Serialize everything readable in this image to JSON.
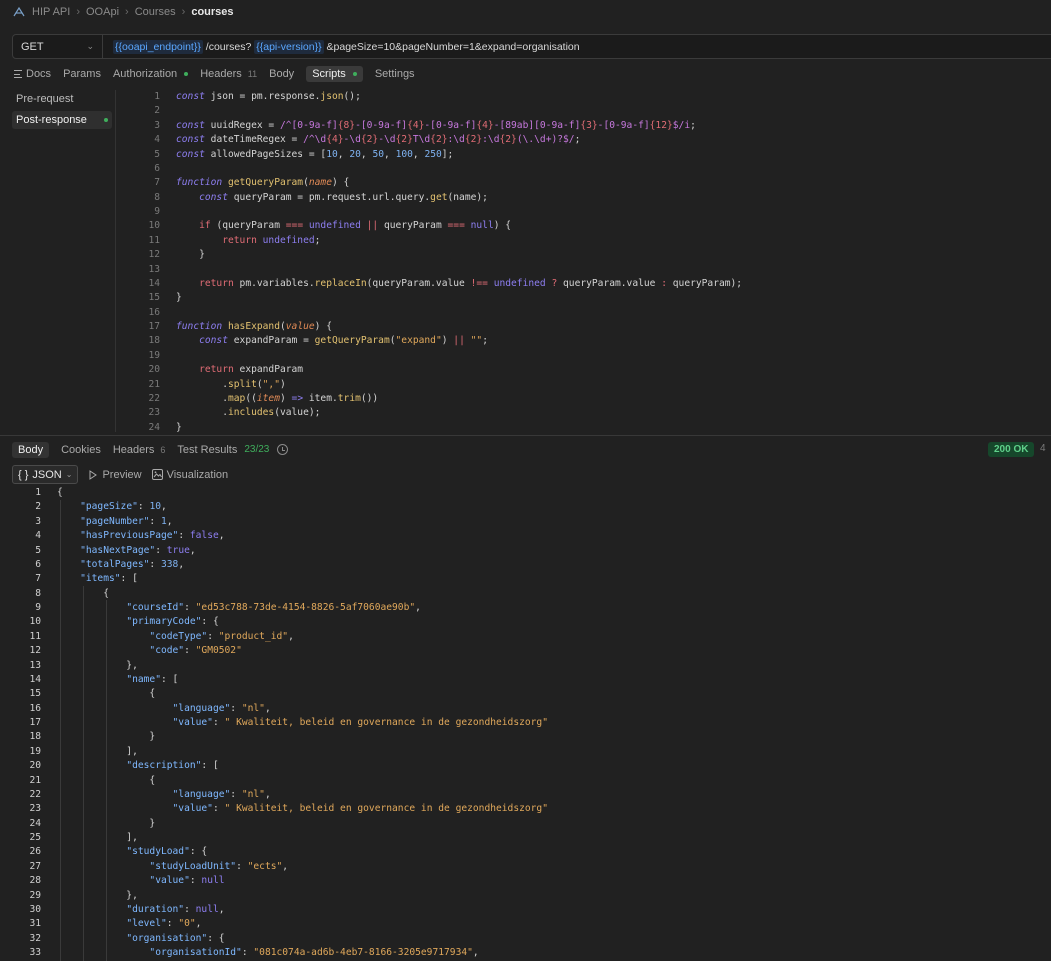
{
  "breadcrumb": [
    "HIP API",
    "OOApi",
    "Courses",
    "courses"
  ],
  "request": {
    "method": "GET",
    "url_var1": "{{ooapi_endpoint}}",
    "url_part1": " /courses? ",
    "url_var2": "{{api-version}}",
    "url_part2": " &pageSize=10&pageNumber=1&expand=organisation"
  },
  "request_tabs": {
    "docs": "Docs",
    "params": "Params",
    "authorization": "Authorization",
    "headers": "Headers",
    "headers_count": "11",
    "body": "Body",
    "scripts": "Scripts",
    "settings": "Settings"
  },
  "script_side": {
    "pre": "Pre-request",
    "post": "Post-response"
  },
  "response_tabs": {
    "body": "Body",
    "cookies": "Cookies",
    "headers": "Headers",
    "headers_count": "6",
    "tests": "Test Results",
    "tests_count": "23/23",
    "status": "200 OK",
    "more": "4"
  },
  "response_toolbar": {
    "format_icon": "{ }",
    "format": "JSON",
    "preview": "Preview",
    "visualization": "Visualization"
  },
  "script_lines": [
    "1",
    "2",
    "3",
    "4",
    "5",
    "6",
    "7",
    "8",
    "9",
    "10",
    "11",
    "12",
    "13",
    "14",
    "15",
    "16",
    "17",
    "18",
    "19",
    "20",
    "21",
    "22",
    "23",
    "24"
  ],
  "json_lines": [
    "1",
    "2",
    "3",
    "4",
    "5",
    "6",
    "7",
    "8",
    "9",
    "10",
    "11",
    "12",
    "13",
    "14",
    "15",
    "16",
    "17",
    "18",
    "19",
    "20",
    "21",
    "22",
    "23",
    "24",
    "25",
    "26",
    "27",
    "28",
    "29",
    "30",
    "31",
    "32",
    "33"
  ]
}
